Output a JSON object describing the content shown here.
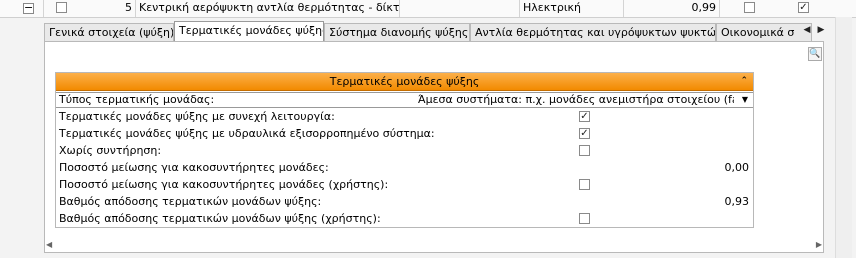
{
  "top_row": {
    "index": "5",
    "name": "Κεντρική αερόψυκτη αντλία θερμότητας - δίκτυ...",
    "energy_source": "Ηλεκτρική",
    "value": "0,99"
  },
  "tabs": [
    {
      "label": "Γενικά στοιχεία (ψύξη)"
    },
    {
      "label": "Τερματικές μονάδες ψύξης"
    },
    {
      "label": "Σύστημα διανομής ψύξης"
    },
    {
      "label": "Αντλία θερμότητας και υγρόψυκτων ψυκτών"
    },
    {
      "label": "Οικονομικά σ"
    }
  ],
  "group": {
    "title": "Τερματικές μονάδες ψύξης",
    "type_label": "Τύπος τερματικής μονάδας:",
    "type_value": "Άμεσα συστήματα: π.χ. μονάδες ανεμιστήρα στοιχείου (fa...",
    "rows": [
      {
        "label": "Τερματικές μονάδες ψύξης με συνεχή λειτουργία:",
        "checked": true
      },
      {
        "label": "Τερματικές μονάδες ψύξης με υδραυλικά εξισορροπημένο σύστημα:",
        "checked": true
      },
      {
        "label": "Χωρίς συντήρηση:",
        "checked": false
      },
      {
        "label": "Ποσοστό μείωσης για κακοσυντήρητες μονάδες:",
        "value": "0,00"
      },
      {
        "label": "Ποσοστό μείωσης για κακοσυντήρητες μονάδες (χρήστης):",
        "checked": false
      },
      {
        "label": "Βαθμός απόδοσης τερματικών μονάδων ψύξης:",
        "value": "0,93"
      },
      {
        "label": "Βαθμός απόδοσης τερματικών μονάδων ψύξης (χρήστης):",
        "checked": false
      }
    ]
  },
  "icons": {
    "expander": "minus-icon",
    "search": "magnifier-icon",
    "tab_left": "triangle-left-icon",
    "tab_right": "triangle-right-icon",
    "collapse": "chevron-up-icon",
    "dropdown": "triangle-down-icon"
  },
  "colors": {
    "group_header_top": "#fcb04a",
    "group_header_bottom": "#f28a00"
  }
}
